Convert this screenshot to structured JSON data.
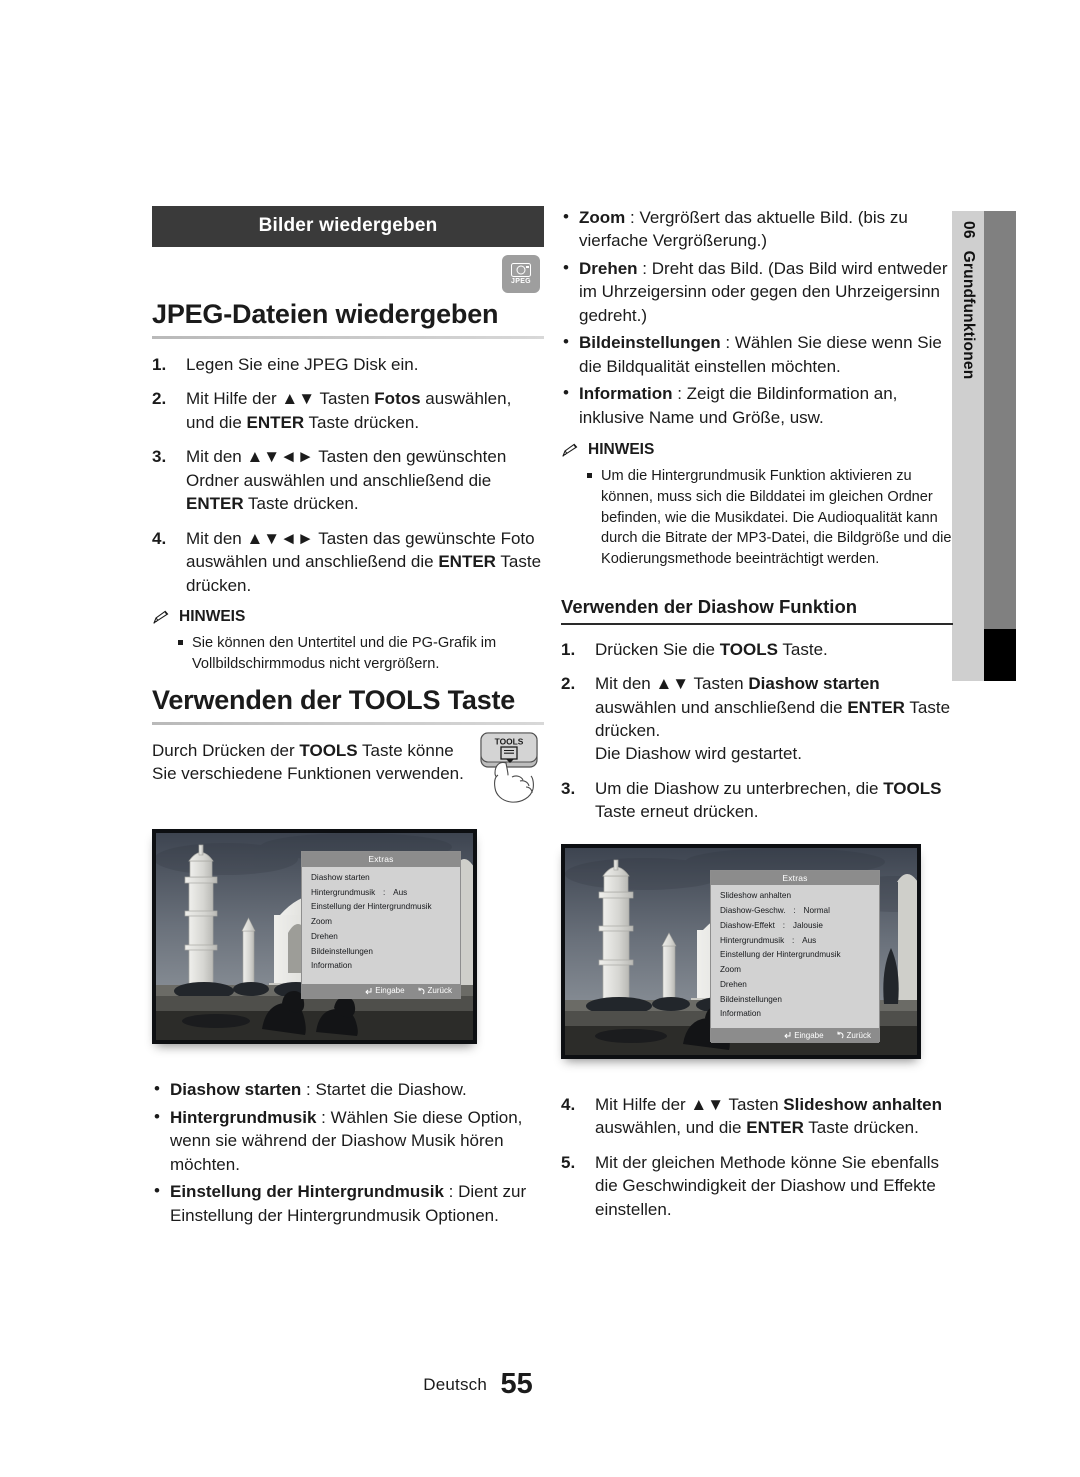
{
  "meta": {
    "language_label": "Deutsch",
    "page_number": "55",
    "chapter_number": "06",
    "chapter_title": "Grundfunktionen"
  },
  "left": {
    "band_title": "Bilder wiedergeben",
    "media_badge": {
      "icon": "camera-icon",
      "label": "JPEG"
    },
    "section_title": "JPEG-Dateien wiedergeben",
    "steps": [
      {
        "n": "1.",
        "html": "Legen Sie eine JPEG Disk ein."
      },
      {
        "n": "2.",
        "html": "Mit Hilfe der ▲▼ Tasten <b>Fotos</b> auswählen, und die <b>ENTER</b> Taste drücken."
      },
      {
        "n": "3.",
        "html": "Mit den ▲▼◄► Tasten den gewünschten Ordner auswählen und anschließend die <b>ENTER</b> Taste drücken."
      },
      {
        "n": "4.",
        "html": "Mit den ▲▼◄► Tasten das gewünschte Foto auswählen und anschließend die <b>ENTER</b> Taste drücken."
      }
    ],
    "note": {
      "icon": "pencil-icon",
      "title": "HINWEIS",
      "items": [
        "Sie können den Untertitel und die PG-Grafik im Vollbildschirmmodus nicht vergrößern."
      ]
    },
    "tools_section_title": "Verwenden der TOOLS Taste",
    "tools_intro_html": "Durch Drücken der <b>TOOLS</b> Taste könne Sie verschiedene Funktionen verwenden.",
    "tools_button_label": "TOOLS",
    "bullets": [
      {
        "term": "Diashow starten",
        "sep": " : ",
        "text": "Startet die Diashow."
      },
      {
        "term": "Hintergrundmusik",
        "sep": " : ",
        "text": "Wählen Sie diese Option, wenn sie während der Diashow Musik hören möchten."
      },
      {
        "term": "Einstellung der Hintergrundmusik",
        "sep": " : ",
        "text": "Dient zur Einstellung der Hintergrundmusik Optionen."
      }
    ],
    "osd": {
      "title": "Extras",
      "rows": [
        {
          "key": "Diashow starten",
          "colon": "",
          "value": ""
        },
        {
          "key": "Hintergrundmusik",
          "colon": ":",
          "value": "Aus"
        },
        {
          "key": "Einstellung der Hintergrundmusik",
          "colon": "",
          "value": ""
        },
        {
          "key": "Zoom",
          "colon": "",
          "value": ""
        },
        {
          "key": "Drehen",
          "colon": "",
          "value": ""
        },
        {
          "key": "Bildeinstellungen",
          "colon": "",
          "value": ""
        },
        {
          "key": "Information",
          "colon": "",
          "value": ""
        }
      ],
      "footer": {
        "enter": "Eingabe",
        "back": "Zurück"
      }
    }
  },
  "right": {
    "bullets": [
      {
        "term": "Zoom",
        "sep": " : ",
        "text": "Vergrößert das aktuelle Bild. (bis zu vierfache Vergrößerung.)"
      },
      {
        "term": "Drehen",
        "sep": " : ",
        "text": "Dreht das Bild. (Das Bild wird entweder im Uhrzeigersinn oder gegen den Uhrzeigersinn gedreht.)"
      },
      {
        "term": "Bildeinstellungen",
        "sep": " : ",
        "text": "Wählen Sie diese wenn Sie die Bildqualität einstellen möchten."
      },
      {
        "term": "Information",
        "sep": " : ",
        "text": "Zeigt die Bildinformation an, inklusive Name und Größe, usw."
      }
    ],
    "note": {
      "icon": "pencil-icon",
      "title": "HINWEIS",
      "items": [
        "Um die Hintergrundmusik Funktion aktivieren zu können, muss sich die Bilddatei im gleichen Ordner befinden, wie die Musikdatei. Die Audioqualität kann durch die Bitrate der MP3-Datei, die Bildgröße und die Kodierungsmethode beeinträchtigt werden."
      ]
    },
    "section_title": "Verwenden der Diashow Funktion",
    "steps_a": [
      {
        "n": "1.",
        "html": "Drücken Sie die <b>TOOLS</b> Taste."
      },
      {
        "n": "2.",
        "html": "Mit den ▲▼ Tasten <b>Diashow starten</b> auswählen und anschließend die <b>ENTER</b> Taste drücken.<br>Die Diashow wird gestartet."
      },
      {
        "n": "3.",
        "html": "Um die Diashow zu unterbrechen, die <b>TOOLS</b> Taste erneut drücken."
      }
    ],
    "steps_b": [
      {
        "n": "4.",
        "html": "Mit Hilfe der ▲▼ Tasten <b>Slideshow anhalten</b> auswählen, und die <b>ENTER</b> Taste drücken."
      },
      {
        "n": "5.",
        "html": "Mit der gleichen Methode könne Sie ebenfalls die Geschwindigkeit der Diashow und Effekte einstellen."
      }
    ],
    "osd": {
      "title": "Extras",
      "rows": [
        {
          "key": "Slideshow anhalten",
          "colon": "",
          "value": ""
        },
        {
          "key": "Diashow-Geschw.",
          "colon": ":",
          "value": "Normal"
        },
        {
          "key": "Diashow-Effekt",
          "colon": ":",
          "value": "Jalousie"
        },
        {
          "key": "Hintergrundmusik",
          "colon": ":",
          "value": "Aus"
        },
        {
          "key": "Einstellung der Hintergrundmusik",
          "colon": "",
          "value": ""
        },
        {
          "key": "Zoom",
          "colon": "",
          "value": ""
        },
        {
          "key": "Drehen",
          "colon": "",
          "value": ""
        },
        {
          "key": "Bildeinstellungen",
          "colon": "",
          "value": ""
        },
        {
          "key": "Information",
          "colon": "",
          "value": ""
        }
      ],
      "footer": {
        "enter": "Eingabe",
        "back": "Zurück"
      }
    }
  },
  "colors": {
    "band_bg": "#3a3a3a",
    "sidebar_light": "#cfcfcf",
    "sidebar_dark": "#808080",
    "sidebar_marker": "#000000",
    "osd_bg": "#d2d2d2",
    "osd_header": "#8c8c8c"
  }
}
